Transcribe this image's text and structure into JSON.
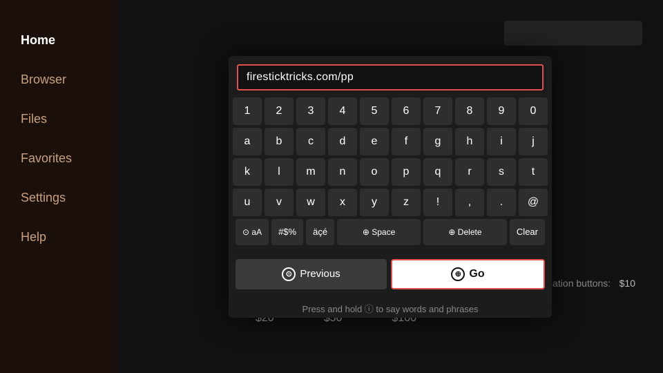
{
  "sidebar": {
    "items": [
      {
        "label": "Home",
        "active": true
      },
      {
        "label": "Browser",
        "active": false
      },
      {
        "label": "Files",
        "active": false
      },
      {
        "label": "Favorites",
        "active": false
      },
      {
        "label": "Settings",
        "active": false
      },
      {
        "label": "Help",
        "active": false
      }
    ]
  },
  "keyboard": {
    "url_value": "firesticktricks.com/pp",
    "rows": [
      [
        "1",
        "2",
        "3",
        "4",
        "5",
        "6",
        "7",
        "8",
        "9",
        "0"
      ],
      [
        "a",
        "b",
        "c",
        "d",
        "e",
        "f",
        "g",
        "h",
        "i",
        "j"
      ],
      [
        "k",
        "l",
        "m",
        "n",
        "o",
        "p",
        "q",
        "r",
        "s",
        "t"
      ],
      [
        "u",
        "v",
        "w",
        "x",
        "y",
        "z",
        "!",
        ",",
        ".",
        "@"
      ]
    ],
    "special_keys": [
      "⊙ aA",
      "#$%",
      "äçé",
      "⊕ Space",
      "⊕ Delete",
      "Clear"
    ],
    "btn_previous": "Previous",
    "btn_go": "Go",
    "hint": "Press and hold ⓘ to say words and phrases"
  },
  "bg": {
    "donation_text": "ease donation buttons:",
    "amounts": [
      "$10",
      "$20",
      "$50",
      "$100"
    ]
  }
}
